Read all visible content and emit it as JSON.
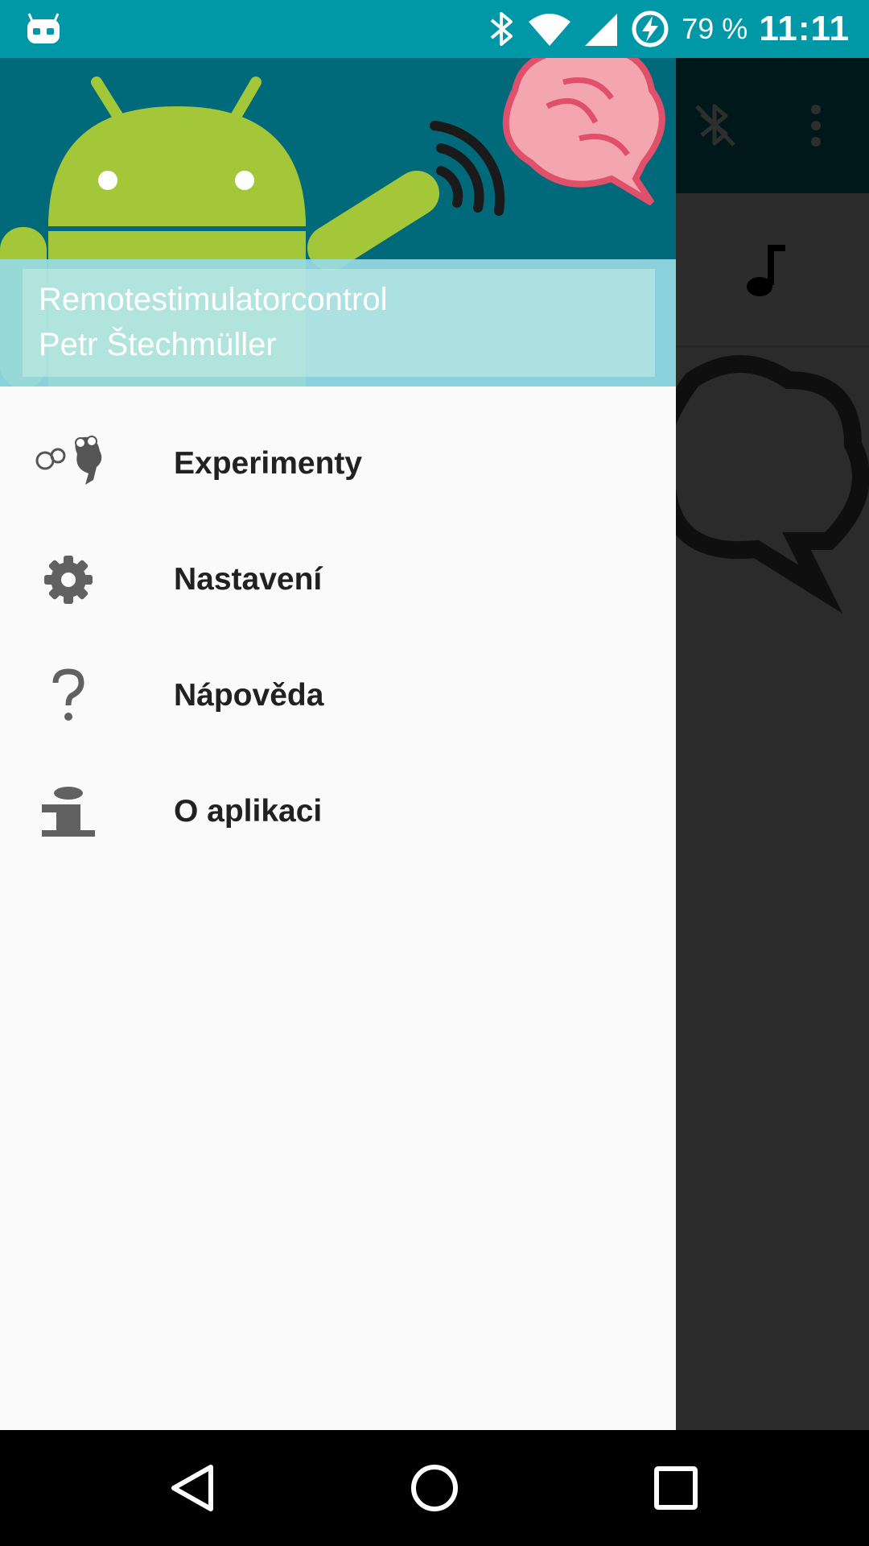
{
  "status_bar": {
    "app_icon": "android-robot-icon",
    "icons": [
      "bluetooth-icon",
      "wifi-icon",
      "cell-signal-icon",
      "battery-charging-icon"
    ],
    "battery_text": "79 %",
    "clock": "11:11",
    "background_color": "#0097a7"
  },
  "background_app": {
    "toolbar_icons": [
      "bluetooth-disabled-icon",
      "overflow-menu-icon"
    ],
    "tab_icon": "music-note-icon",
    "toolbar_color": "#00838f"
  },
  "drawer": {
    "header": {
      "title": "Remotestimulatorcontrol",
      "subtitle": "Petr Štechmüller",
      "artwork": "android-robot-brain-illustration"
    },
    "items": [
      {
        "label": "Experimenty",
        "icon": "experiments-head-icon"
      },
      {
        "label": "Nastavení",
        "icon": "settings-gear-icon"
      },
      {
        "label": "Nápověda",
        "icon": "help-question-icon"
      },
      {
        "label": "O aplikaci",
        "icon": "info-icon"
      }
    ]
  },
  "nav_bar": {
    "buttons": [
      "back-icon",
      "home-icon",
      "recents-icon"
    ]
  }
}
